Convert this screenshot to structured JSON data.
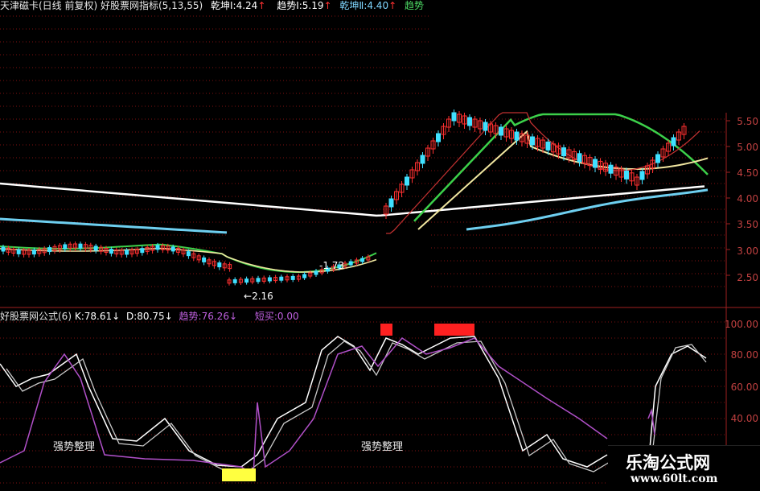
{
  "header": {
    "title": "天津磁卡(日线 前复权) 好股票网指标(5,13,55)",
    "items": [
      {
        "label": "乾坤Ⅰ:",
        "value": "4.24",
        "arrow": "↑",
        "color": "#ffffff"
      },
      {
        "label": "趋势Ⅰ:",
        "value": "5.19",
        "arrow": "↑",
        "color": "#ffffff"
      },
      {
        "label": "乾坤Ⅱ:",
        "value": "4.40",
        "arrow": "↑",
        "color": "#7fd6ff"
      },
      {
        "label": "趋势",
        "value": "",
        "arrow": "",
        "color": "#4cd964"
      }
    ]
  },
  "price_axis": [
    "5.50",
    "5.00",
    "4.50",
    "4.00",
    "3.50",
    "3.00",
    "2.50"
  ],
  "price_annotations": {
    "low": "2.16",
    "high": "1.73"
  },
  "indicator_header": {
    "name": "好股票网公式(6)",
    "k_label": "K:",
    "k_value": "78.61",
    "k_arrow": "↓",
    "d_label": "D:",
    "d_value": "80.75",
    "d_arrow": "↓",
    "trend_label": "趋势:",
    "trend_value": "76.26",
    "trend_arrow": "↓",
    "short_buy_label": "短买:",
    "short_buy_value": "0.00"
  },
  "indicator_axis": [
    "100.00",
    "80.00",
    "60.00",
    "40.00"
  ],
  "notes": [
    "强势整理",
    "强势整理"
  ],
  "watermark": {
    "name": "乐淘公式网",
    "url": "www.60lt.com"
  },
  "colors": {
    "up": "#ff3030",
    "down": "#40e0ff",
    "ma_white": "#ffffff",
    "ma_green": "#3cd04a",
    "ma_yellow": "#f0e6a0",
    "ma_cyan": "#6ecff0",
    "grid": "#801010",
    "k_line": "#ffffff",
    "d_line": "#c8c8c8",
    "trend_line": "#b050c8",
    "signal_red": "#ff2020",
    "signal_yellow": "#ffff40"
  }
}
